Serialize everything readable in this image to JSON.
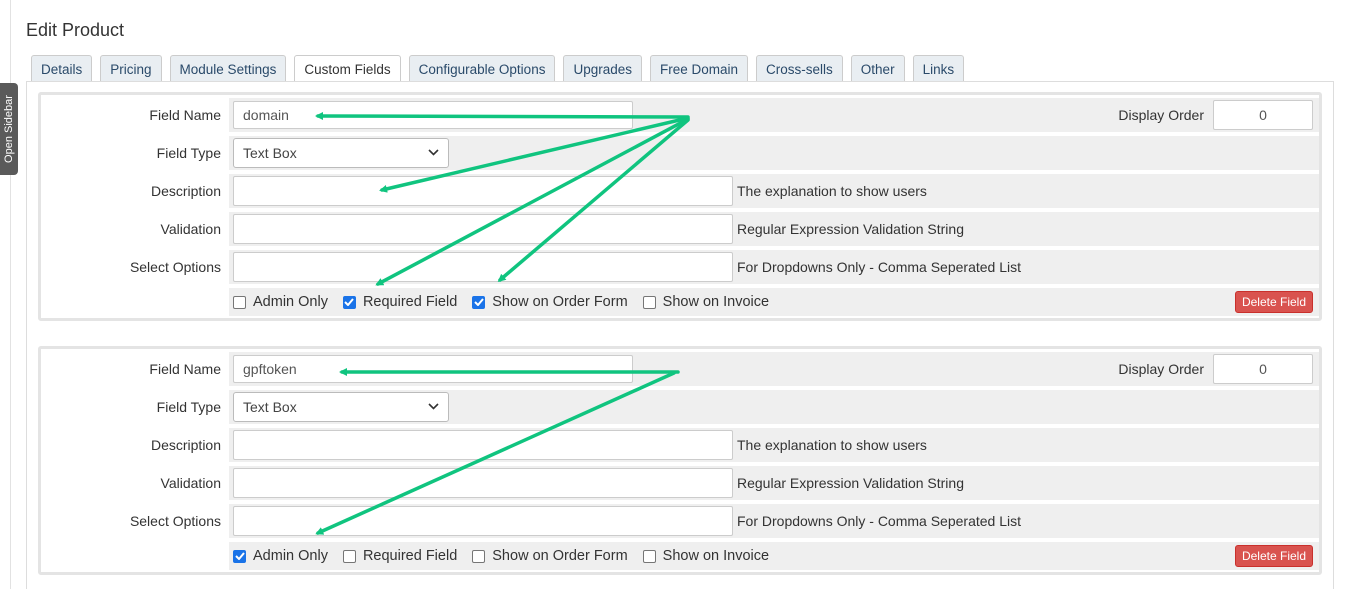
{
  "sidebar_toggle": "Open Sidebar",
  "page_title": "Edit Product",
  "tabs": [
    {
      "label": "Details",
      "active": false
    },
    {
      "label": "Pricing",
      "active": false
    },
    {
      "label": "Module Settings",
      "active": false
    },
    {
      "label": "Custom Fields",
      "active": true
    },
    {
      "label": "Configurable Options",
      "active": false
    },
    {
      "label": "Upgrades",
      "active": false
    },
    {
      "label": "Free Domain",
      "active": false
    },
    {
      "label": "Cross-sells",
      "active": false
    },
    {
      "label": "Other",
      "active": false
    },
    {
      "label": "Links",
      "active": false
    }
  ],
  "labels": {
    "field_name": "Field Name",
    "field_type": "Field Type",
    "description": "Description",
    "validation": "Validation",
    "select_options": "Select Options",
    "display_order": "Display Order",
    "description_hint": "The explanation to show users",
    "validation_hint": "Regular Expression Validation String",
    "select_options_hint": "For Dropdowns Only - Comma Seperated List",
    "admin_only": "Admin Only",
    "required_field": "Required Field",
    "show_on_order_form": "Show on Order Form",
    "show_on_invoice": "Show on Invoice",
    "delete_field": "Delete Field"
  },
  "fields": [
    {
      "field_name": "domain",
      "field_type": "Text Box",
      "description": "",
      "validation": "",
      "select_options": "",
      "display_order": "0",
      "admin_only": false,
      "required_field": true,
      "show_on_order_form": true,
      "show_on_invoice": false
    },
    {
      "field_name": "gpftoken",
      "field_type": "Text Box",
      "description": "",
      "validation": "",
      "select_options": "",
      "display_order": "0",
      "admin_only": true,
      "required_field": false,
      "show_on_order_form": false,
      "show_on_invoice": false
    }
  ],
  "colors": {
    "annotation_arrow": "#10c47f",
    "checkbox_checked": "#1a73e8",
    "delete_button": "#d9534f",
    "row_background": "#efefef"
  }
}
